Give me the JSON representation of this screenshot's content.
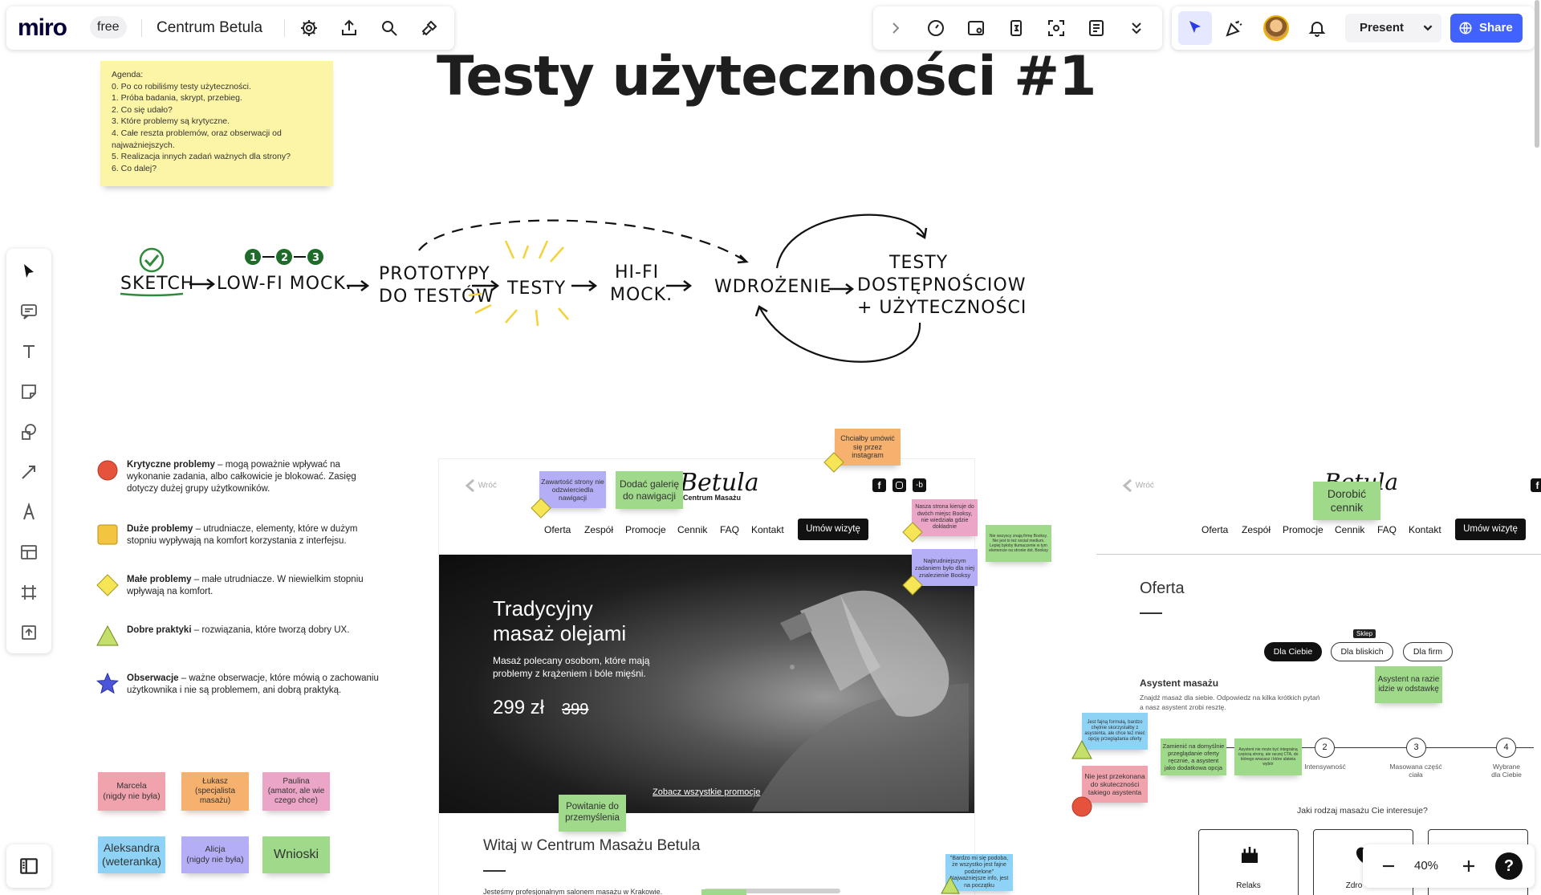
{
  "app": {
    "logo": "miro",
    "plan_badge": "free",
    "board_name": "Centrum Betula"
  },
  "toolbar_right": {
    "present_label": "Present",
    "share_label": "Share"
  },
  "board": {
    "title": "Testy użyteczności #1",
    "agenda": {
      "heading": "Agenda:",
      "lines": [
        "0. Po co robiliśmy testy użyteczności.",
        "1. Próba badania, skrypt, przebieg.",
        "2. Co się udało?",
        "3. Które problemy są krytyczne.",
        "4. Całe reszta problemów, oraz obserwacji od",
        "najważniejszych.",
        "5. Realizacja innych zadań ważnych dla strony?",
        "6. Co dalej?"
      ]
    },
    "flow": {
      "steps": [
        "SKETCH",
        "LOW-FI MOCK.",
        "PROTOTYPY",
        "DO TESTÓW",
        "TESTY",
        "HI-FI",
        "MOCK.",
        "WDROŻENIE",
        "TESTY",
        "DOSTĘPNOŚCIOWE",
        "+ UŻYTECZNOŚCIOWE"
      ],
      "numbers": [
        "1",
        "2",
        "3"
      ]
    },
    "legend": [
      {
        "title": "Krytyczne problemy",
        "text": " – mogą poważnie wpływać na wykonanie zadania, albo całkowicie je blokować. Zasięg dotyczy dużej grupy użytkowników.",
        "shape": "red-circle"
      },
      {
        "title": "Duże problemy",
        "text": " – utrudniacze, elementy, które w dużym stopniu wypływają na komfort korzystania z interfejsu.",
        "shape": "orange-square"
      },
      {
        "title": "Małe problemy",
        "text": " – małe utrudniacze. W niewielkim stopniu wpływają na komfort.",
        "shape": "yellow-diamond"
      },
      {
        "title": "Dobre praktyki",
        "text": " – rozwiązania, które tworzą dobry UX.",
        "shape": "green-triangle"
      },
      {
        "title": "Obserwacje",
        "text": " – ważne obserwacje, które mówią o zachowaniu użytkownika i nie są problemem, ani dobrą praktyką.",
        "shape": "blue-star"
      }
    ],
    "people": [
      {
        "label": "Marcela\n(nigdy nie była)",
        "color": "#f1a3ad"
      },
      {
        "label": "Łukasz\n(specjalista\nmasażu)",
        "color": "#f7b16e"
      },
      {
        "label": "Paulina\n(amator, ale wie\nczego chce)",
        "color": "#eba6c7"
      },
      {
        "label": "Aleksandra\n(weteranka)",
        "color": "#8ed3f6"
      },
      {
        "label": "Alicja\n(nigdy nie była)",
        "color": "#b3aef5"
      },
      {
        "label": "Wnioski",
        "color": "#9fd98a"
      }
    ],
    "page1": {
      "back": "Wróć",
      "brand": "Betula",
      "brand_sub": "Centrum Masażu",
      "nav": [
        "Oferta",
        "Zespół",
        "Promocje",
        "Cennik",
        "FAQ",
        "Kontakt"
      ],
      "cta": "Umów wizytę",
      "hero_title_1": "Tradycyjny",
      "hero_title_2": "masaż olejami",
      "hero_sub_1": "Masaż polecany osobom, które mają",
      "hero_sub_2": "problemy z krążeniem i bóle mięśni.",
      "price": "299 zł",
      "old_price": "399",
      "promo_link": "Zobacz wszystkie promocje",
      "welcome": "Witaj w Centrum Masażu Betula",
      "intro": "Jesteśmy profesjonalnym salonem masażu w Krakowie."
    },
    "page2": {
      "back": "Wróć",
      "nav": [
        "Oferta",
        "Zespół",
        "Promocje",
        "Cennik",
        "FAQ",
        "Kontakt"
      ],
      "cta": "Umów wizytę",
      "heading": "Oferta",
      "tooltip": "Sklep",
      "tabs": [
        "Dla Ciebie",
        "Dla bliskich",
        "Dla firm"
      ],
      "assistant_title": "Asystent masażu",
      "assistant_text_1": "Znajdź masaż dla siebie. Odpowiedz na kilka krótkich pytań",
      "assistant_text_2": "a nasz asystent zrobi resztę.",
      "steps": [
        {
          "n": "2",
          "label": "Intensywność"
        },
        {
          "n": "3",
          "label": "Masowana część\nciała"
        },
        {
          "n": "4",
          "label": "Wybrane\ndla Ciebie"
        }
      ],
      "question": "Jaki rodzaj masażu Cie interesuje?",
      "cards": [
        "Relaks",
        "Zdro"
      ]
    },
    "stickies": [
      {
        "text": "Chciałby umówić się przez instagram",
        "color": "#f7b16e"
      },
      {
        "text": "Zawartość strony nie odzwierciedla nawigacji",
        "color": "#b3aef5"
      },
      {
        "text": "Dodać galerię do nawigacji",
        "color": "#9fd98a"
      },
      {
        "text": "Nasza strona kieruje do dwóch miejsc Booksy, nie wiedziała gdzie dokładnie",
        "color": "#eba6c7"
      },
      {
        "text": "Nie wszyscy znają firmę Booksy. Nie jest to też social medium. Lepiej byłoby tłumaczenie w tym elemencie na stronie dot. Booksy",
        "color": "#9fd98a"
      },
      {
        "text": "Najtrudniejszym zadaniem było dla niej znalezienie Booksy",
        "color": "#b3aef5"
      },
      {
        "text": "Powitanie do przemyślenia",
        "color": "#9fd98a"
      },
      {
        "text": "\"Bardzo mi się podoba, że wszystko jest fajne podzielone\" Najważniejsze info, jest na początku",
        "color": "#8ed3f6"
      },
      {
        "text": "Dorobić cennik",
        "color": "#9fd98a"
      },
      {
        "text": "Asystent na razie idzie w odstawkę",
        "color": "#9fd98a"
      },
      {
        "text": "Jest fajną formułą, bardzo chętnie skorzystałby z asystenta, ale chce też mieć opcję przeglądania oferty",
        "color": "#8ed3f6"
      },
      {
        "text": "Zamienić na domyślnie przeglądanie oferty ręcznie, a asystent jako dodatkowa opcja",
        "color": "#9fd98a"
      },
      {
        "text": "Asystent nie może być integralną częścią strony, ale raczej CTA, do którego wracasz i które ułatwia wybór",
        "color": "#9fd98a"
      },
      {
        "text": "Nie jest przekonana do skuteczności takiego asystenta",
        "color": "#f1a3ad"
      }
    ],
    "zoom": "40%",
    "help": "?"
  }
}
